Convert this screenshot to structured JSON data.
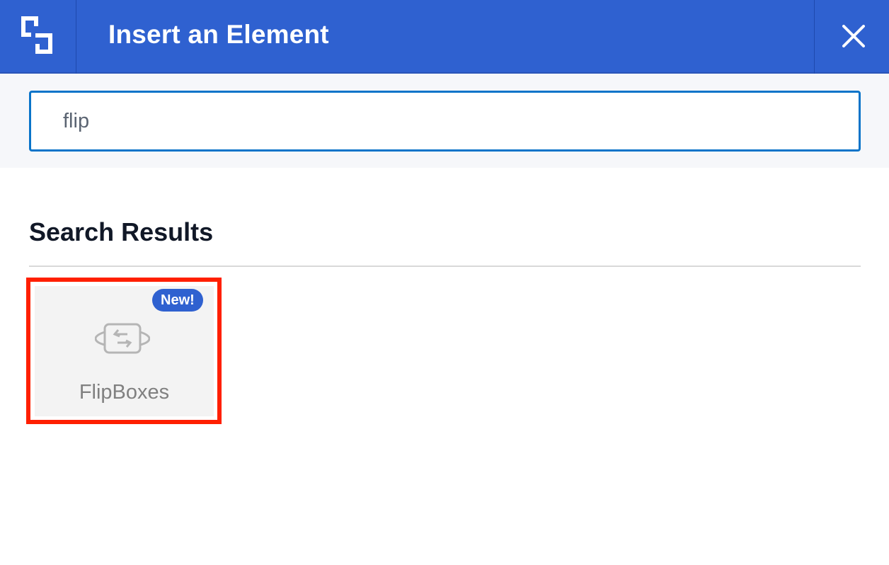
{
  "header": {
    "title": "Insert an Element",
    "logo_icon": "builder-logo-icon",
    "close_icon": "close-icon",
    "brand_color": "#2f61d0"
  },
  "search": {
    "value": "flip",
    "focus_color": "#0a74c9"
  },
  "results": {
    "heading": "Search Results",
    "items": [
      {
        "label": "FlipBoxes",
        "badge": "New!",
        "icon": "flip-box-icon",
        "selected": true,
        "highlight_color": "#ff1f00"
      }
    ]
  }
}
